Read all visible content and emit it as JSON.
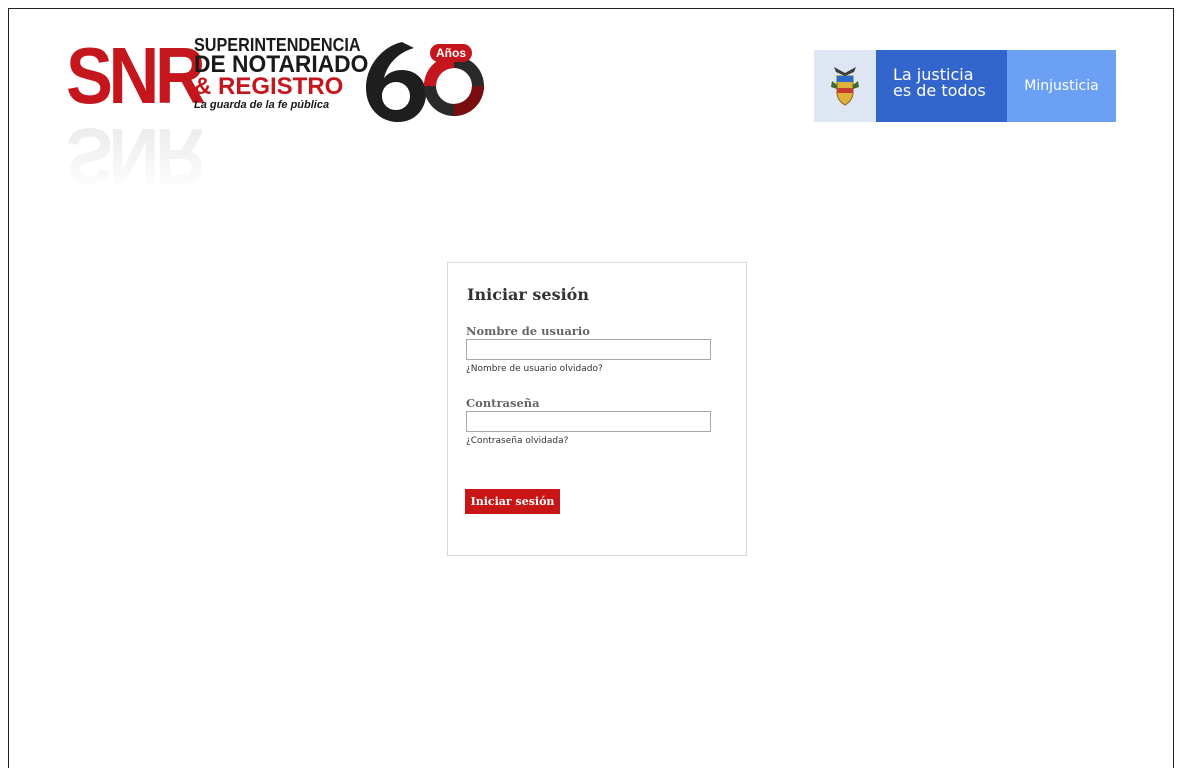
{
  "header": {
    "snr_logo": {
      "letters": "SNR",
      "line1": "SUPERINTENDENCIA",
      "line2": "DE NOTARIADO",
      "line3": "& REGISTRO",
      "tagline": "La guarda de la fe pública",
      "anniversary_number": "60",
      "anniversary_label": "Años",
      "brand_color": "#c4161c"
    },
    "minjusticia_banner": {
      "slogan_line1": "La justicia",
      "slogan_line2": "es de todos",
      "name": "Minjusticia",
      "icon": "colombia-coat-of-arms-icon",
      "colors": {
        "shield_bg": "#dfe6f3",
        "slogan_bg": "#3366cc",
        "name_bg": "#6ba0f5"
      }
    }
  },
  "login": {
    "title": "Iniciar sesión",
    "username_label": "Nombre de usuario",
    "username_value": "",
    "forgot_username": "¿Nombre de usuario olvidado?",
    "password_label": "Contraseña",
    "password_value": "",
    "forgot_password": "¿Contraseña olvidada?",
    "submit_label": "Iniciar sesión",
    "submit_color": "#c91515"
  }
}
